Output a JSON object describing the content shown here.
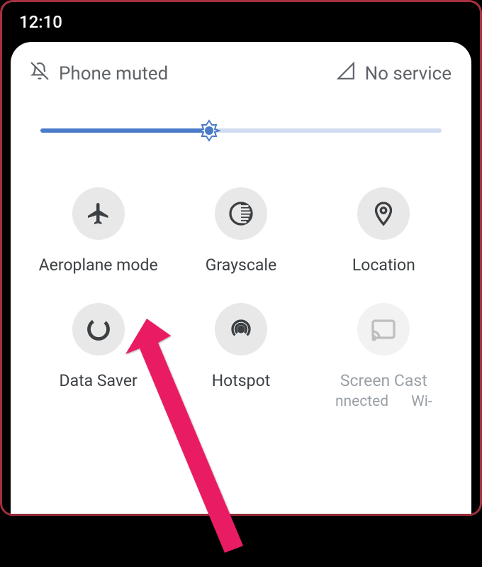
{
  "status": {
    "time": "12:10"
  },
  "header": {
    "muted_label": "Phone muted",
    "service_label": "No service"
  },
  "brightness": {
    "percent": 42
  },
  "tiles": [
    {
      "id": "aeroplane",
      "label": "Aeroplane mode",
      "icon": "airplane-icon"
    },
    {
      "id": "grayscale",
      "label": "Grayscale",
      "icon": "contrast-icon"
    },
    {
      "id": "location",
      "label": "Location",
      "icon": "location-pin-icon"
    },
    {
      "id": "datasaver",
      "label": "Data Saver",
      "icon": "data-saver-icon"
    },
    {
      "id": "hotspot",
      "label": "Hotspot",
      "icon": "hotspot-icon"
    },
    {
      "id": "screencast",
      "label": "Screen Cast",
      "icon": "cast-icon",
      "sublabel_left": "nnected",
      "sublabel_right": "Wi-"
    }
  ],
  "annotation": {
    "color": "#e91e63",
    "target": "aeroplane"
  }
}
